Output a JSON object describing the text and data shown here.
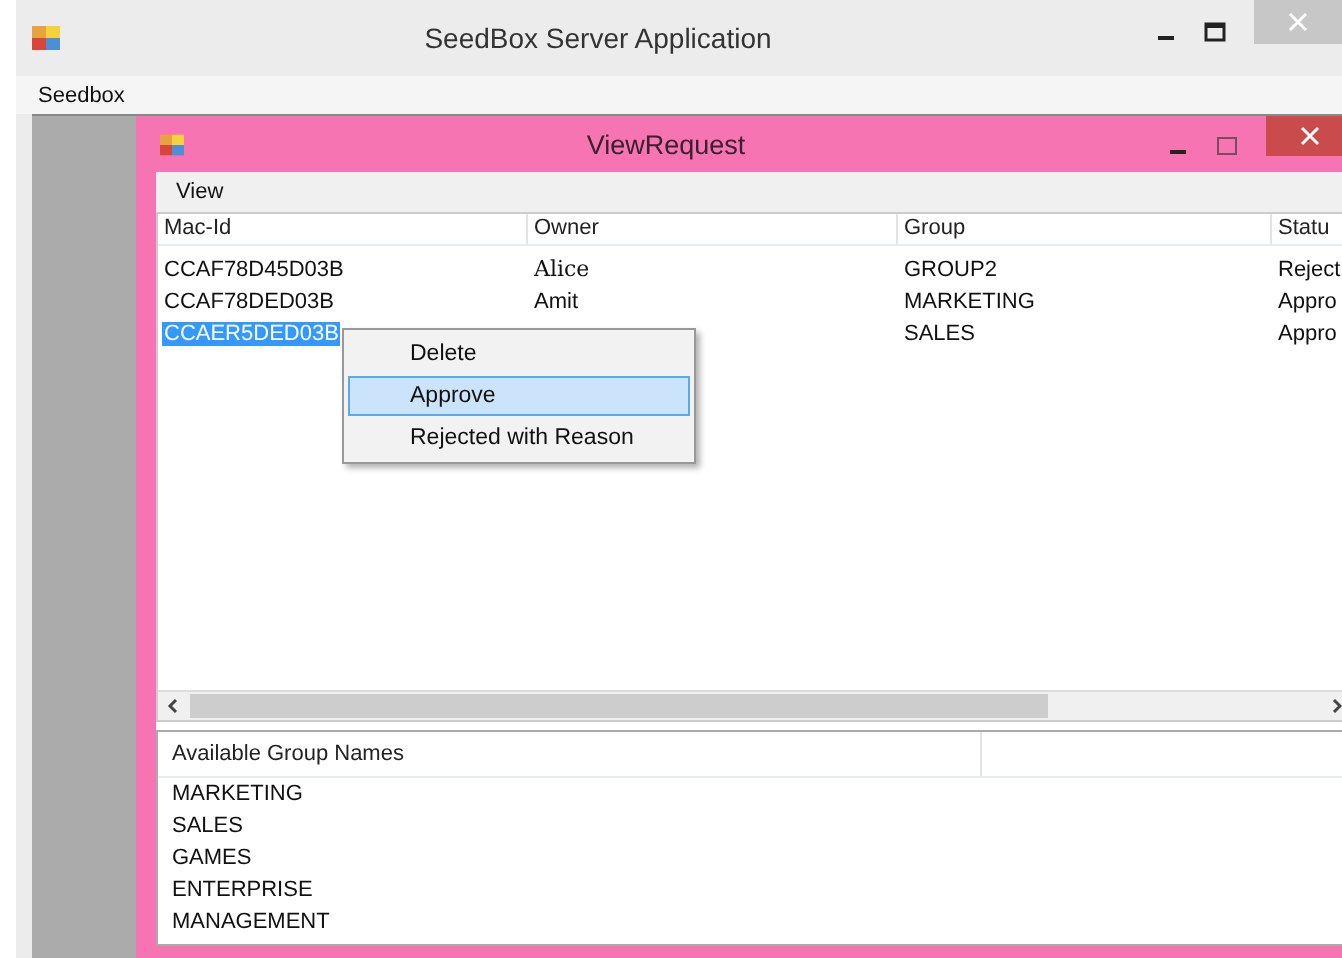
{
  "window": {
    "title": "SeedBox Server Application"
  },
  "menu": [
    "Seedbox"
  ],
  "child_window": {
    "title": "ViewRequest",
    "menu": [
      "View"
    ],
    "table": {
      "columns": [
        "Mac-Id",
        "Owner",
        "Group",
        "Statu"
      ],
      "rows": [
        {
          "cells": [
            "CCAF78D45D03B",
            "Alice",
            "GROUP2",
            "Reject"
          ],
          "selected": false
        },
        {
          "cells": [
            "CCAF78DED03B",
            "Amit",
            "MARKETING",
            "Appro"
          ],
          "selected": false
        },
        {
          "cells": [
            "CCAER5DED03B",
            null,
            "SALES",
            "Appro"
          ],
          "selected": true
        }
      ]
    },
    "context_menu": [
      {
        "label": "Delete",
        "selected": false
      },
      {
        "label": "Approve",
        "selected": true
      },
      {
        "label": "Rejected with Reason",
        "selected": false
      }
    ],
    "groups": {
      "column": "Available Group Names",
      "items": [
        "MARKETING",
        "SALES",
        "GAMES",
        "ENTERPRISE",
        "MANAGEMENT"
      ]
    }
  }
}
